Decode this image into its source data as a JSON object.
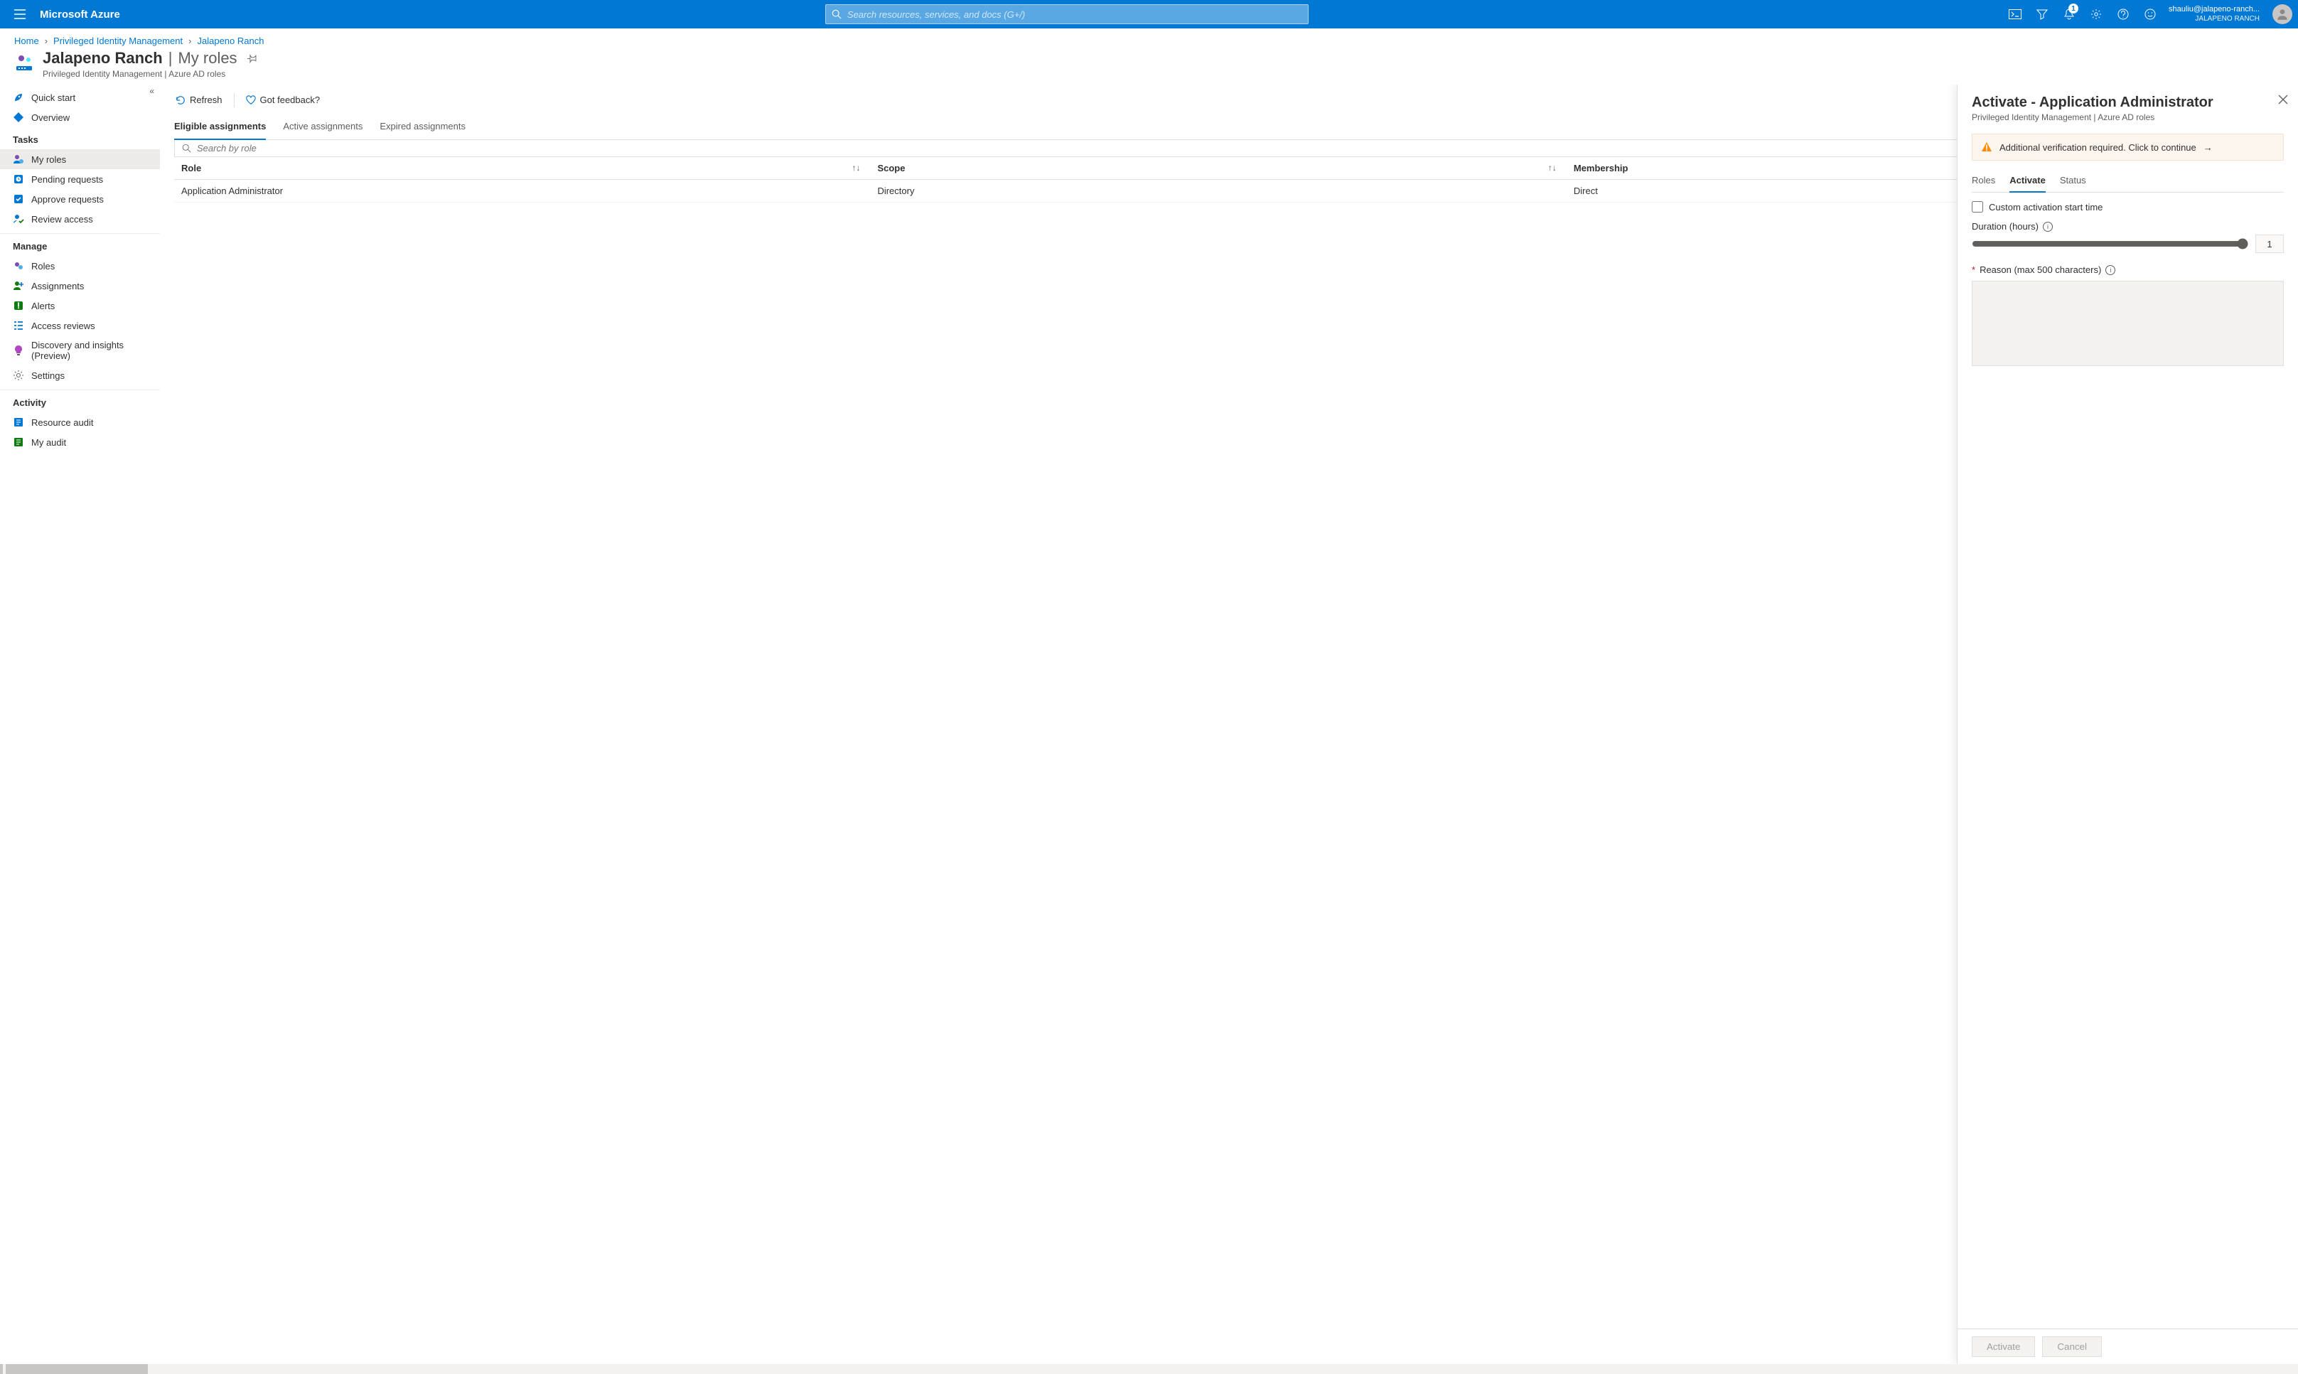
{
  "topbar": {
    "brand": "Microsoft Azure",
    "search_placeholder": "Search resources, services, and docs (G+/)",
    "notification_count": "1",
    "user_email": "shauliu@jalapeno-ranch...",
    "tenant": "JALAPENO RANCH"
  },
  "breadcrumbs": [
    {
      "label": "Home"
    },
    {
      "label": "Privileged Identity Management"
    },
    {
      "label": "Jalapeno Ranch"
    }
  ],
  "page": {
    "title": "Jalapeno Ranch",
    "section": "My roles",
    "subtitle": "Privileged Identity Management | Azure AD roles"
  },
  "cmdbar": {
    "refresh": "Refresh",
    "feedback": "Got feedback?"
  },
  "sidebar": {
    "top": [
      {
        "icon": "quickstart",
        "label": "Quick start"
      },
      {
        "icon": "overview",
        "label": "Overview"
      }
    ],
    "groups": [
      {
        "title": "Tasks",
        "items": [
          {
            "icon": "myroles",
            "label": "My roles",
            "active": true
          },
          {
            "icon": "pending",
            "label": "Pending requests"
          },
          {
            "icon": "approve",
            "label": "Approve requests"
          },
          {
            "icon": "review",
            "label": "Review access"
          }
        ]
      },
      {
        "title": "Manage",
        "items": [
          {
            "icon": "roles",
            "label": "Roles"
          },
          {
            "icon": "assign",
            "label": "Assignments"
          },
          {
            "icon": "alerts",
            "label": "Alerts"
          },
          {
            "icon": "areview",
            "label": "Access reviews"
          },
          {
            "icon": "discover",
            "label": "Discovery and insights (Preview)"
          },
          {
            "icon": "settings",
            "label": "Settings"
          }
        ]
      },
      {
        "title": "Activity",
        "items": [
          {
            "icon": "raudit",
            "label": "Resource audit"
          },
          {
            "icon": "maudit",
            "label": "My audit"
          }
        ]
      }
    ]
  },
  "tabs": {
    "eligible": "Eligible assignments",
    "active": "Active assignments",
    "expired": "Expired assignments"
  },
  "role_search_placeholder": "Search by role",
  "columns": {
    "role": "Role",
    "scope": "Scope",
    "membership": "Membership"
  },
  "rows": [
    {
      "role": "Application Administrator",
      "scope": "Directory",
      "membership": "Direct"
    }
  ],
  "panel": {
    "title": "Activate - Application Administrator",
    "subtitle": "Privileged Identity Management | Azure AD roles",
    "warning": "Additional verification required. Click to continue",
    "tabs": {
      "roles": "Roles",
      "activate": "Activate",
      "status": "Status"
    },
    "custom_start": "Custom activation start time",
    "duration_label": "Duration (hours)",
    "duration_value": "1",
    "reason_label": "Reason (max 500 characters)",
    "activate_btn": "Activate",
    "cancel_btn": "Cancel"
  }
}
